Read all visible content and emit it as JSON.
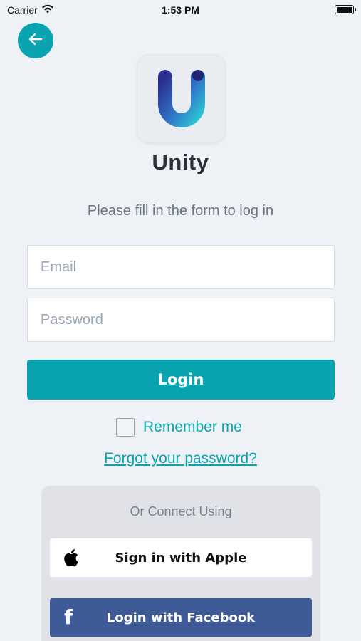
{
  "status_bar": {
    "carrier": "Carrier",
    "time": "1:53 PM"
  },
  "header": {
    "back_icon": "arrow-left-icon"
  },
  "brand": {
    "logo_icon": "unity-u-logo",
    "name": "Unity"
  },
  "form": {
    "subtitle": "Please fill in the form to log in",
    "email_placeholder": "Email",
    "email_value": "",
    "password_placeholder": "Password",
    "password_value": "",
    "login_label": "Login",
    "remember_label": "Remember me",
    "remember_checked": false,
    "forgot_label": "Forgot your password?"
  },
  "social": {
    "title": "Or Connect Using",
    "apple_label": "Sign in with Apple",
    "apple_icon": "apple-icon",
    "facebook_label": "Login with Facebook",
    "facebook_icon": "facebook-icon"
  },
  "colors": {
    "accent": "#0aa3b0",
    "background": "#eef1f5",
    "facebook": "#3e5b98"
  }
}
